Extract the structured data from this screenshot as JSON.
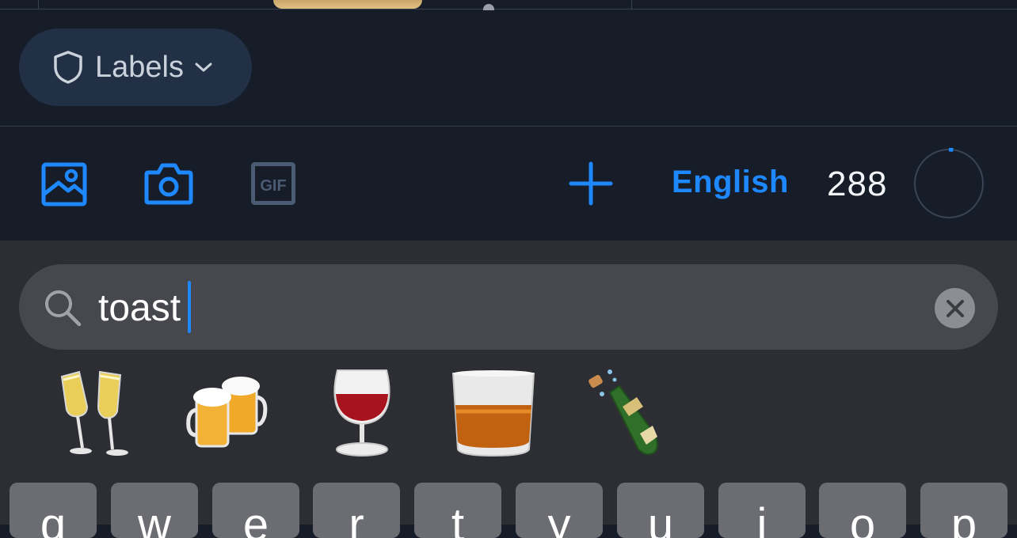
{
  "labels_button": {
    "label": "Labels",
    "icon": "shield-icon"
  },
  "toolbar": {
    "image_icon": "image-icon",
    "camera_icon": "camera-icon",
    "gif_label": "GIF",
    "add_icon": "plus-icon",
    "language": "English",
    "char_count": "288",
    "char_progress": 0.02
  },
  "search": {
    "value": "toast",
    "icon": "search-icon",
    "clear_icon": "clear-icon"
  },
  "emoji_results": [
    "clinking-glasses",
    "clinking-beer-mugs",
    "wine-glass",
    "tumbler-glass",
    "bottle-with-popping-cork"
  ],
  "keyboard": {
    "row1": [
      "q",
      "w",
      "e",
      "r",
      "t",
      "y",
      "u",
      "i",
      "o",
      "p"
    ]
  },
  "colors": {
    "accent": "#1d88ff",
    "background": "#161c28",
    "keyboard": "#2c2e33"
  }
}
